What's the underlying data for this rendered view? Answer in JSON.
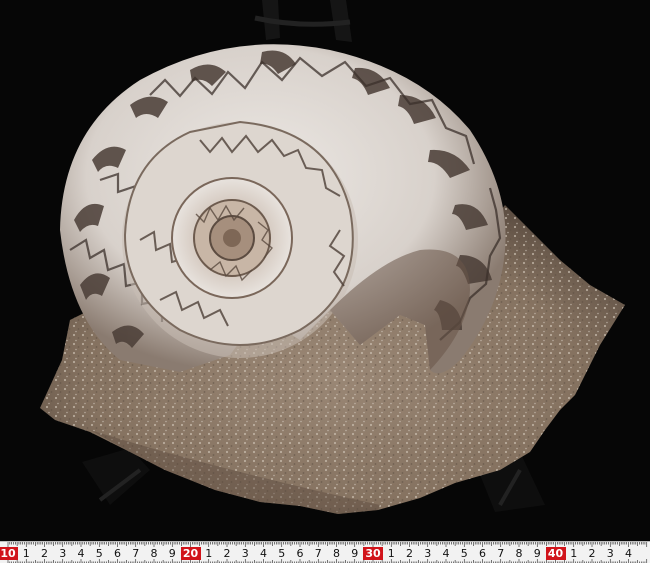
{
  "ruler": {
    "labels": [
      "10",
      "1",
      "2",
      "3",
      "4",
      "5",
      "6",
      "7",
      "8",
      "9",
      "20",
      "1",
      "2",
      "3",
      "4",
      "5",
      "6",
      "7",
      "8",
      "9",
      "30",
      "1",
      "2",
      "3",
      "4",
      "5",
      "6",
      "7",
      "8",
      "9",
      "40",
      "1",
      "2",
      "3",
      "4"
    ],
    "highlight_labels": [
      "10",
      "20",
      "30",
      "40"
    ],
    "highlight_color": "#d1141b"
  },
  "colors": {
    "background": "#060606",
    "matrix_rock": "#8f7c6a",
    "shell_white": "#e6e1dc",
    "shell_dark_band": "#4a3d36"
  }
}
